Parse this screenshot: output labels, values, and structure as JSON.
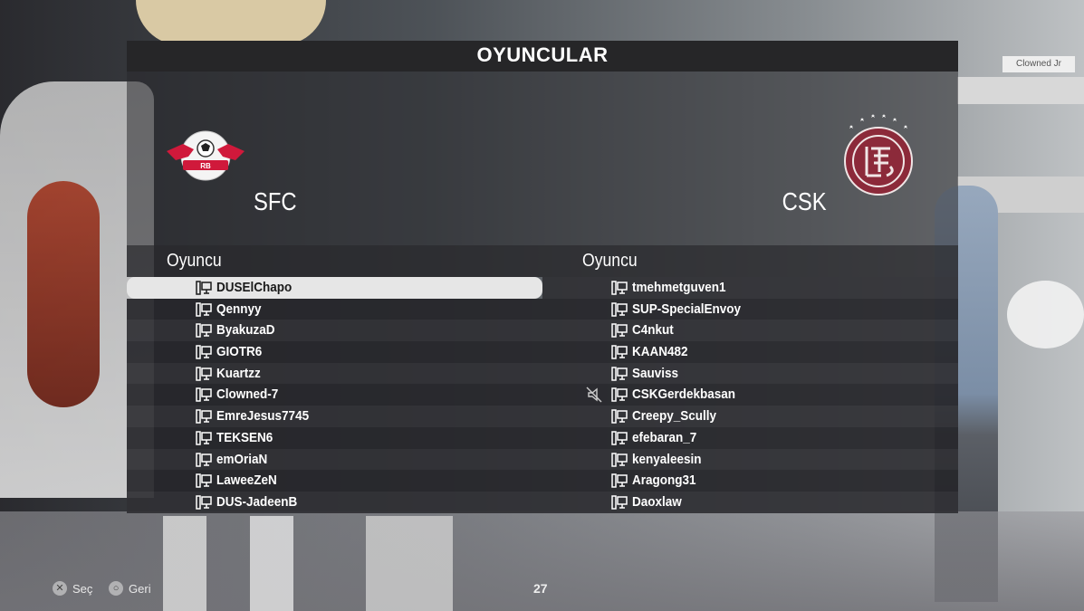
{
  "title": "OYUNCULAR",
  "teams": {
    "left": {
      "name": "SFC",
      "logo": "rb-leipzig-crest"
    },
    "right": {
      "name": "CSK",
      "logo": "lanus-crest-with-stars"
    }
  },
  "left_column": {
    "header": "Oyuncu",
    "players": [
      {
        "name": "DUSElChapo",
        "selected": true,
        "muted": false
      },
      {
        "name": "Qennyy",
        "selected": false,
        "muted": false
      },
      {
        "name": "ByakuzaD",
        "selected": false,
        "muted": false
      },
      {
        "name": "GIOTR6",
        "selected": false,
        "muted": false
      },
      {
        "name": "Kuartzz",
        "selected": false,
        "muted": false
      },
      {
        "name": "Clowned-7",
        "selected": false,
        "muted": false
      },
      {
        "name": "EmreJesus7745",
        "selected": false,
        "muted": false
      },
      {
        "name": "TEKSEN6",
        "selected": false,
        "muted": false
      },
      {
        "name": "emOriaN",
        "selected": false,
        "muted": false
      },
      {
        "name": "LaweeZeN",
        "selected": false,
        "muted": false
      },
      {
        "name": "DUS-JadeenB",
        "selected": false,
        "muted": false
      }
    ]
  },
  "right_column": {
    "header": "Oyuncu",
    "players": [
      {
        "name": "tmehmetguven1",
        "muted": false
      },
      {
        "name": "SUP-SpecialEnvoy",
        "muted": false
      },
      {
        "name": "C4nkut",
        "muted": false
      },
      {
        "name": "KAAN482",
        "muted": false
      },
      {
        "name": "Sauviss",
        "muted": false
      },
      {
        "name": "CSKGerdekbasan",
        "muted": true
      },
      {
        "name": "Creepy_Scully",
        "muted": false
      },
      {
        "name": "efebaran_7",
        "muted": false
      },
      {
        "name": "kenyaleesin",
        "muted": false
      },
      {
        "name": "Aragong31",
        "muted": false
      },
      {
        "name": "Daoxlaw",
        "muted": false
      }
    ]
  },
  "footer": {
    "select_label": "Seç",
    "back_label": "Geri",
    "page_number": "27"
  },
  "background_tag": "Clowned Jr",
  "colors": {
    "title_bar": "#262628",
    "selected_row": "#e6e6e6",
    "right_crest": "#8c2a3a"
  }
}
